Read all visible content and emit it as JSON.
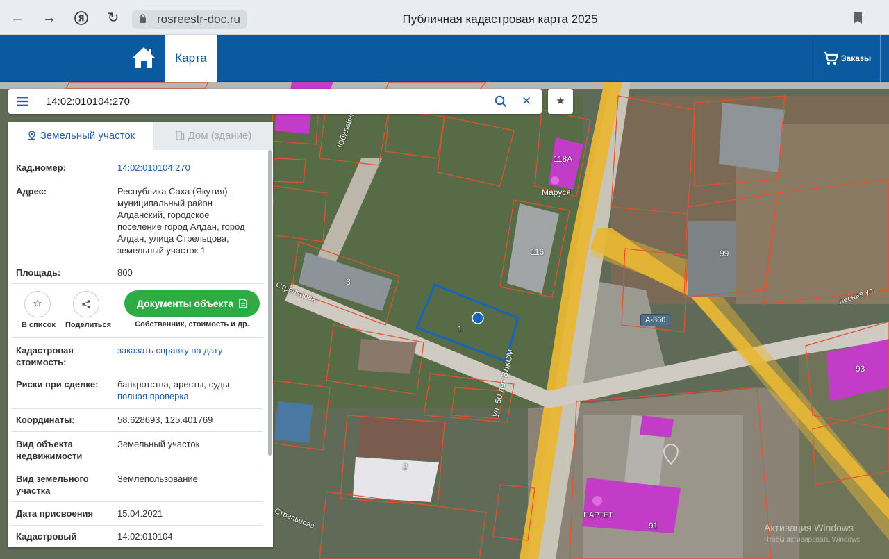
{
  "browser": {
    "url": "rosreestr-doc.ru",
    "title": "Публичная кадастровая карта 2025"
  },
  "header": {
    "map_tab": "Карта",
    "orders": "Заказы"
  },
  "search": {
    "value": "14:02:010104:270"
  },
  "tabs": {
    "land": "Земельный участок",
    "building": "Дом (здание)"
  },
  "info": {
    "cad_number_label": "Кад.номер:",
    "cad_number": "14:02:010104:270",
    "address_label": "Адрес:",
    "address": "Республика Саха (Якутия), муниципальный район Алданский, городское поселение город Алдан, город Алдан, улица Стрельцова, земельный участок 1",
    "area_label": "Площадь:",
    "area": "800",
    "cad_value_label": "Кадастровая стоимость:",
    "cad_value_link": "заказать справку на дату",
    "risks_label": "Риски при сделке:",
    "risks": "банкротства, аресты, суды",
    "risks_link": "полная проверка",
    "coords_label": "Координаты:",
    "coords": "58.628693, 125.401769",
    "object_type_label": "Вид объекта недвижимости",
    "object_type": "Земельный участок",
    "land_type_label": "Вид земельного участка",
    "land_type": "Землепользование",
    "date_label": "Дата присвоения",
    "date": "15.04.2021",
    "quarter_label": "Кадастровый",
    "quarter": "14:02:010104"
  },
  "actions": {
    "to_list": "В список",
    "share": "Поделиться",
    "docs_button": "Документы объекта",
    "docs_caption": "Собственник, стоимость и др."
  },
  "map_labels": {
    "building_118a": "118А",
    "marusya": "Маруся",
    "building_116": "116",
    "building_3": "3",
    "plot_1": "1",
    "building_99": "99",
    "building_93": "93",
    "building_2": "2",
    "building_91": "91",
    "partet": "ПАРТЕТ",
    "road_badge": "А-360",
    "street_50let": "ул. 50 лет ВЛКСМ",
    "street_streltsova": "Стрельцова",
    "street_streltsova2": "Стрельцова",
    "street_lesnaya": "Лесная ул.",
    "street_yubileynaya": "Юбилейная"
  },
  "watermark": {
    "line1": "Активация Windows",
    "line2": "Чтобы активировать Windows"
  },
  "colors": {
    "header_blue": "#0b5a9f",
    "docs_green": "#2eab44",
    "link_blue": "#1f5ea8",
    "plot_outline": "#1565c0",
    "road_yellow": "#e9b734",
    "building_magenta": "#c23cc8",
    "cadastral_red": "#e2522e"
  }
}
